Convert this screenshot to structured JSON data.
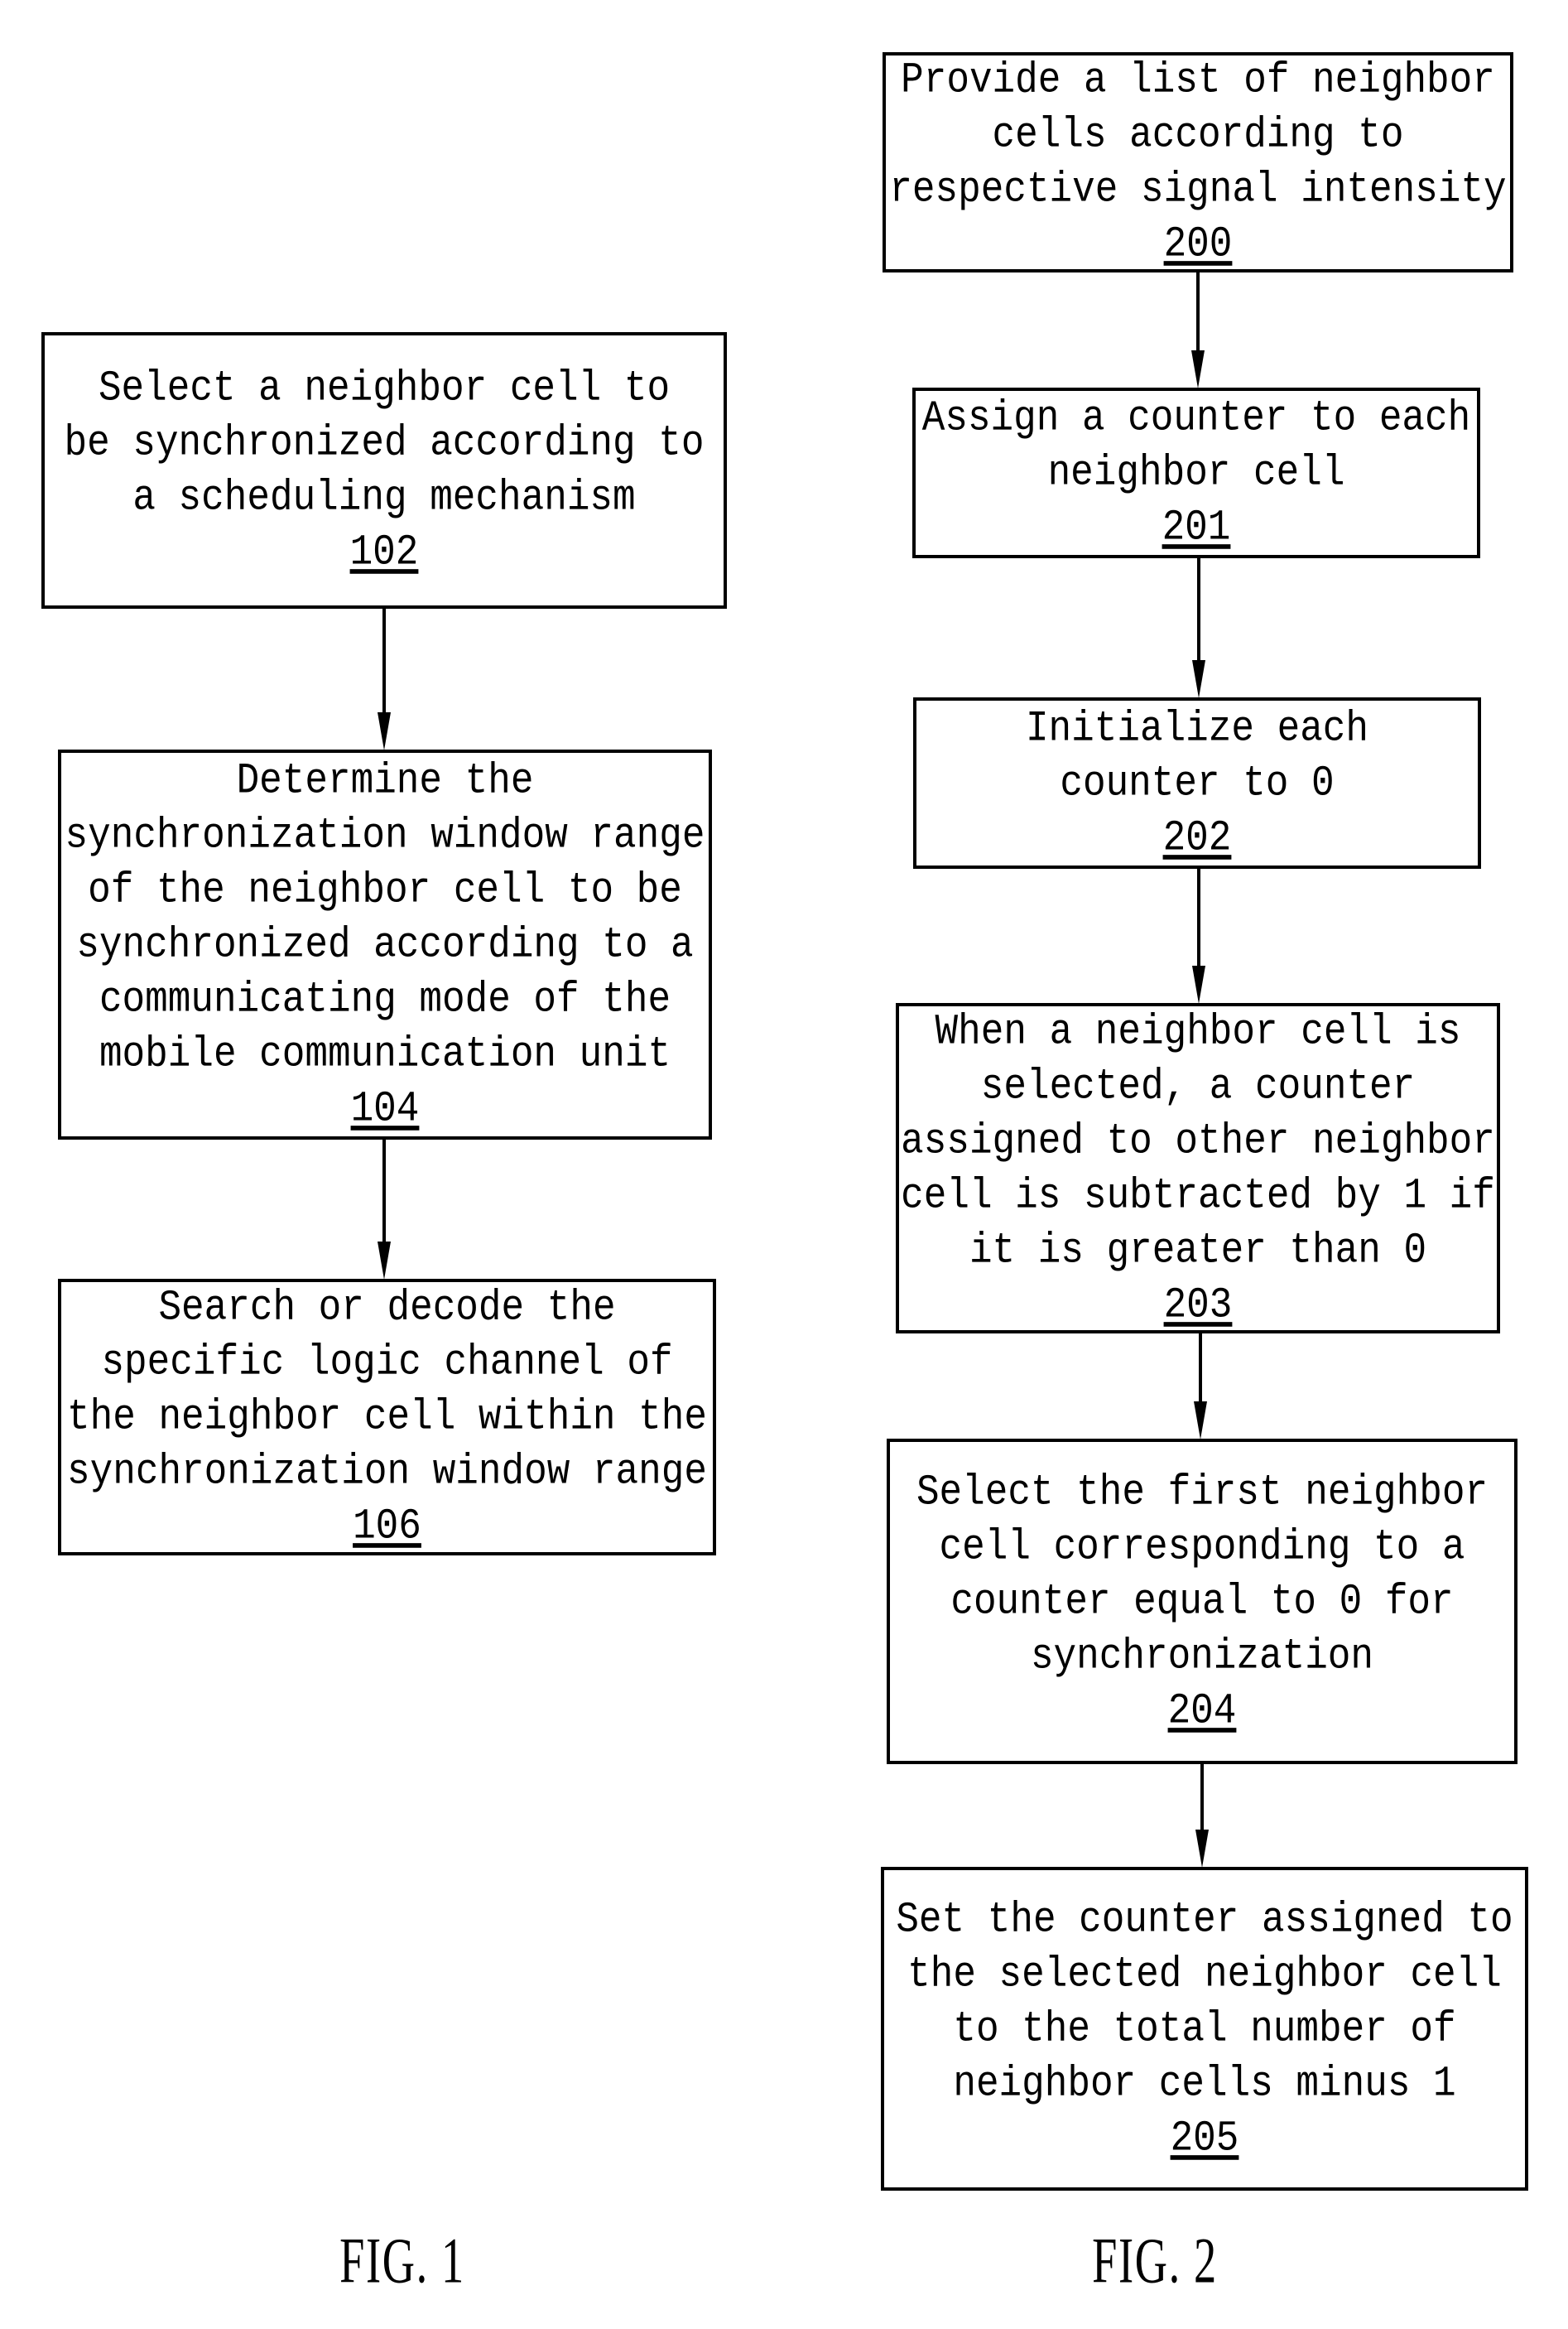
{
  "figures": [
    {
      "label": "FIG. 1",
      "steps": [
        {
          "ref": "102",
          "lines": [
            "Select a neighbor cell to",
            "be synchronized according to",
            "a scheduling mechanism"
          ]
        },
        {
          "ref": "104",
          "lines": [
            "Determine the",
            "synchronization window range",
            "of the neighbor cell to be",
            "synchronized according to a",
            "communicating mode of the",
            "mobile communication unit"
          ]
        },
        {
          "ref": "106",
          "lines": [
            "Search or decode the",
            "specific logic channel of",
            "the neighbor cell within the",
            "synchronization window range"
          ]
        }
      ]
    },
    {
      "label": "FIG. 2",
      "steps": [
        {
          "ref": "200",
          "lines": [
            "Provide a list of neighbor",
            "cells according to",
            "respective signal intensity"
          ]
        },
        {
          "ref": "201",
          "lines": [
            "Assign a counter to each",
            "neighbor cell"
          ]
        },
        {
          "ref": "202",
          "lines": [
            "Initialize each",
            "counter to 0"
          ]
        },
        {
          "ref": "203",
          "lines": [
            "When a neighbor cell is",
            "selected, a counter",
            "assigned to other neighbor",
            "cell is subtracted by 1 if",
            "it is greater than 0"
          ]
        },
        {
          "ref": "204",
          "lines": [
            "Select the first neighbor",
            "cell corresponding to a",
            "counter equal to 0 for",
            "synchronization"
          ]
        },
        {
          "ref": "205",
          "lines": [
            "Set the counter assigned to",
            "the selected neighbor cell",
            "to the total number of",
            "neighbor cells minus 1"
          ]
        }
      ]
    }
  ]
}
